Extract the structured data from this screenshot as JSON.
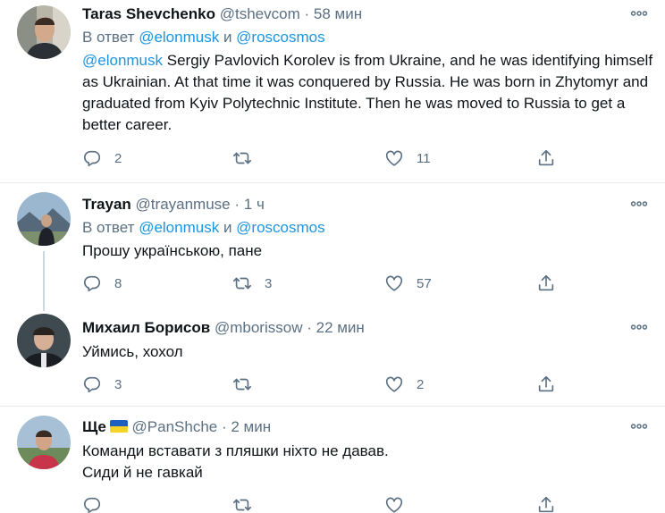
{
  "tweets": [
    {
      "name": "Taras Shevchenko",
      "handle": "@tshevcom",
      "dot": "·",
      "time": "58 мин",
      "reply_prefix": "В ответ",
      "reply_user1": "@elonmusk",
      "reply_and": "и",
      "reply_user2": "@roscosmos",
      "mention": "@elonmusk",
      "text": "Sergiy Pavlovich Korolev is from Ukraine, and he was identifying himself as Ukrainian. At that time it was conquered by Russia. He was born in Zhytomyr and graduated from Kyiv Polytechnic Institute. Then he was moved to Russia to get a better career.",
      "replies": "2",
      "retweets": "",
      "likes": "11"
    },
    {
      "name": "Trayan",
      "handle": "@trayanmuse",
      "dot": "·",
      "time": "1 ч",
      "reply_prefix": "В ответ",
      "reply_user1": "@elonmusk",
      "reply_and": "и",
      "reply_user2": "@roscosmos",
      "text": "Прошу українською, пане",
      "replies": "8",
      "retweets": "3",
      "likes": "57"
    },
    {
      "name": "Михаил Борисов",
      "handle": "@mborissow",
      "dot": "·",
      "time": "22 мин",
      "text": "Уймись, хохол",
      "replies": "3",
      "retweets": "",
      "likes": "2"
    },
    {
      "name": "Ще",
      "handle": "@PanShche",
      "dot": "·",
      "time": "2 мин",
      "text_line1": "Команди вставати з пляшки ніхто не давав.",
      "text_line2": "Сиди й не гавкай",
      "replies": "",
      "retweets": "",
      "likes": ""
    }
  ],
  "icons": {
    "reply": "reply-icon",
    "retweet": "retweet-icon",
    "like": "heart-icon",
    "share": "share-icon",
    "more": "more-icon"
  },
  "colors": {
    "link": "#1b95e0",
    "secondary_text": "#5b7083",
    "separator": "#e6ecf0"
  }
}
